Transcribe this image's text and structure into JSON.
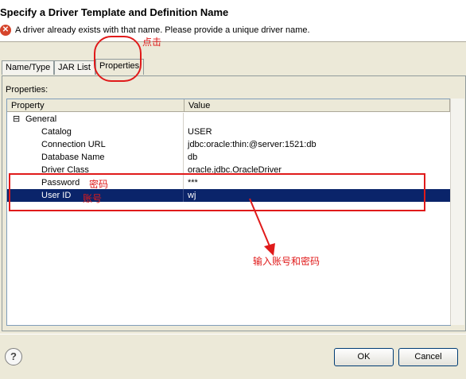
{
  "dialog": {
    "title": "Specify a Driver Template and Definition Name",
    "error_message": "A driver already exists with that name. Please provide a unique driver name."
  },
  "tabs": [
    {
      "label": "Name/Type",
      "active": false
    },
    {
      "label": "JAR List",
      "active": false
    },
    {
      "label": "Properties",
      "active": true
    }
  ],
  "properties": {
    "section_label": "Properties:",
    "columns": {
      "property": "Property",
      "value": "Value"
    },
    "group": {
      "label": "General",
      "expander": "⊟"
    },
    "rows": [
      {
        "property": "Catalog",
        "value": "USER",
        "selected": false
      },
      {
        "property": "Connection URL",
        "value": "jdbc:oracle:thin:@server:1521:db",
        "selected": false
      },
      {
        "property": "Database Name",
        "value": "db",
        "selected": false
      },
      {
        "property": "Driver Class",
        "value": "oracle.jdbc.OracleDriver",
        "selected": false
      },
      {
        "property": "Password",
        "value": "***",
        "selected": false
      },
      {
        "property": "User ID",
        "value": "wj",
        "selected": true
      }
    ]
  },
  "annotations": {
    "click_note": "点击",
    "password_note": "密码",
    "account_note": "账号",
    "input_note": "输入账号和密码",
    "color": "#e01a1a"
  },
  "buttons": {
    "help_label": "?",
    "ok_label": "OK",
    "cancel_label": "Cancel"
  },
  "icons": {
    "error": "error-icon",
    "help": "help-icon"
  }
}
